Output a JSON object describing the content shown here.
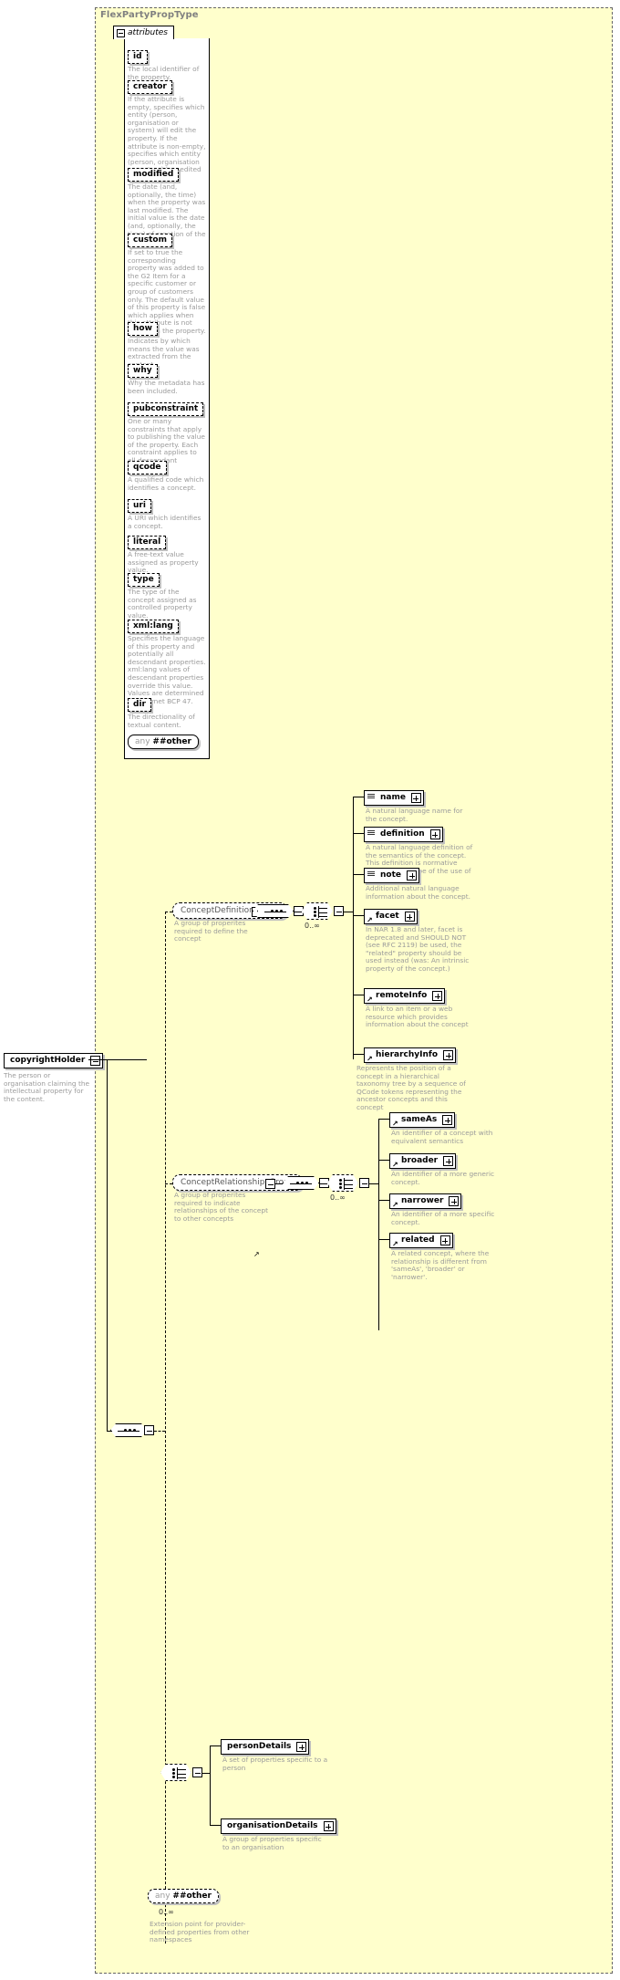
{
  "type_panel": {
    "title": "FlexPartyPropType"
  },
  "attributes_section": {
    "label": "attributes",
    "items": [
      {
        "name": "id",
        "desc": "The local identifier of the property."
      },
      {
        "name": "creator",
        "desc": "If the attribute is empty, specifies which entity (person, organisation or system) will edit the property. If the attribute is non-empty, specifies which entity (person, organisation or system) has edited the property."
      },
      {
        "name": "modified",
        "desc": "The date (and, optionally, the time) when the property was last modified. The initial value is the date (and, optionally, the time) of creation of the property."
      },
      {
        "name": "custom",
        "desc": "If set to true the corresponding property was added to the G2 Item for a specific customer or group of customers only. The default value of this property is false which applies when this attribute is not used with the property."
      },
      {
        "name": "how",
        "desc": "Indicates by which means the value was extracted from the content."
      },
      {
        "name": "why",
        "desc": "Why the metadata has been included."
      },
      {
        "name": "pubconstraint",
        "desc": "One or many constraints that apply to publishing the value of the property. Each constraint applies to all descendant elements."
      },
      {
        "name": "qcode",
        "desc": "A qualified code which identifies a concept."
      },
      {
        "name": "uri",
        "desc": "A URI which identifies a concept."
      },
      {
        "name": "literal",
        "desc": "A free-text value assigned as property value."
      },
      {
        "name": "type",
        "desc": "The type of the concept assigned as controlled property value."
      },
      {
        "name": "xml:lang",
        "desc": "Specifies the language of this property and potentially all descendant properties. xml:lang values of descendant properties override this value. Values are determined by Internet BCP 47."
      },
      {
        "name": "dir",
        "desc": "The directionality of textual content."
      }
    ],
    "any_prefix": "any",
    "any_name": "##other"
  },
  "root_element": {
    "name": "copyrightHolder",
    "desc": "The person or organisation claiming the intellectual property for the content."
  },
  "groups": {
    "concept_definition": {
      "name": "ConceptDefinitionGroup",
      "desc": "A group of properites required to define the concept",
      "occurrence": "0..∞",
      "children": [
        {
          "name": "name",
          "desc": "A natural language name for the concept."
        },
        {
          "name": "definition",
          "desc": "A natural language definition of the semantics of the concept. This definition is normative only for the scope of the use of this concept."
        },
        {
          "name": "note",
          "desc": "Additional natural language information about the concept."
        },
        {
          "name": "facet",
          "desc": "In NAR 1.8 and later, facet is deprecated and SHOULD NOT (see RFC 2119) be used, the \"related\" property should be used instead (was: An intrinsic property of the concept.)"
        },
        {
          "name": "remoteInfo",
          "desc": "A link to an item or a web resource which provides information about the concept"
        },
        {
          "name": "hierarchyInfo",
          "desc": "Represents the position of a concept in a hierarchical taxonomy tree by a sequence of QCode tokens representing the ancestor concepts and this concept"
        }
      ]
    },
    "concept_relationships": {
      "name": "ConceptRelationshipsGroup",
      "desc": "A group of properites required to indicate relationships of the concept to other concepts",
      "occurrence": "0..∞",
      "children": [
        {
          "name": "sameAs",
          "desc": "An identifier of a concept with equivalent semantics"
        },
        {
          "name": "broader",
          "desc": "An identifier of a more generic concept."
        },
        {
          "name": "narrower",
          "desc": "An identifier of a more specific concept."
        },
        {
          "name": "related",
          "desc": "A related concept, where the relationship is different from 'sameAs', 'broader' or 'narrower'."
        }
      ]
    },
    "details_choice": {
      "children": [
        {
          "name": "personDetails",
          "desc": "A set of properties specific to a person"
        },
        {
          "name": "organisationDetails",
          "desc": "A group of properties specific to an organisation"
        }
      ]
    },
    "any_block": {
      "prefix": "any",
      "name": "##other",
      "occurrence": "0..∞",
      "desc": "Extension point for provider-defined properties from other namespaces"
    }
  }
}
